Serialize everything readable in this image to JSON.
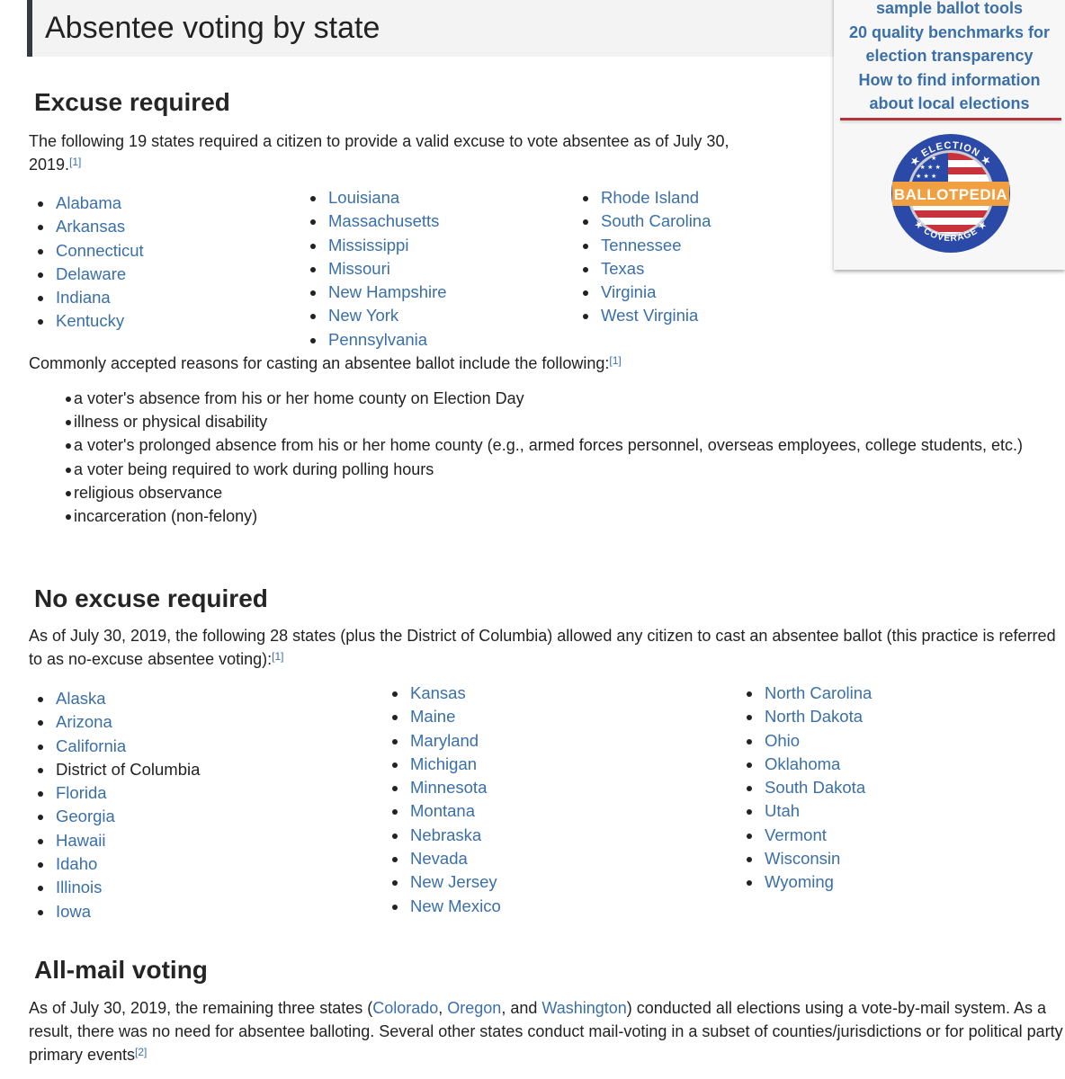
{
  "page_title": "Absentee voting by state",
  "sidebar": {
    "links": [
      "sample ballot tools",
      "20 quality benchmarks for",
      "election transparency",
      "How to find information",
      "about local elections"
    ],
    "logo": {
      "top_text": "ELECTION",
      "banner_text": "BALLOTPEDIA",
      "bottom_text": "COVERAGE",
      "colors": {
        "ring": "#2b4aa8",
        "banner": "#f0a040",
        "stripe": "#c8323a"
      }
    }
  },
  "sections": {
    "excuse_required": {
      "heading": "Excuse required",
      "intro_line1": "The following 19 states required a citizen to provide a valid excuse to vote absentee as of July 30,",
      "intro_line2": "2019.",
      "intro_ref": "[1]",
      "states_col1": [
        "Alabama",
        "Arkansas",
        "Connecticut",
        "Delaware",
        "Indiana",
        "Kentucky"
      ],
      "states_col2": [
        "Louisiana",
        "Massachusetts",
        "Mississippi",
        "Missouri",
        "New Hampshire",
        "New York",
        "Pennsylvania"
      ],
      "states_col3": [
        "Rhode Island",
        "South Carolina",
        "Tennessee",
        "Texas",
        "Virginia",
        "West Virginia"
      ],
      "reasons_intro": "Commonly accepted reasons for casting an absentee ballot include the following:",
      "reasons_ref": "[1]",
      "reasons": [
        "a voter's absence from his or her home county on Election Day",
        "illness or physical disability",
        "a voter's prolonged absence from his or her home county (e.g., armed forces personnel, overseas employees, college students, etc.)",
        "a voter being required to work during polling hours",
        "religious observance",
        "incarceration (non-felony)"
      ]
    },
    "no_excuse": {
      "heading": "No excuse required",
      "intro": "As of July 30, 2019, the following 28 states (plus the District of Columbia) allowed any citizen to cast an absentee ballot (this practice is referred to as no-excuse absentee voting):",
      "intro_ref": "[1]",
      "states_col1": [
        "Alaska",
        "Arizona",
        "California",
        "District of Columbia",
        "Florida",
        "Georgia",
        "Hawaii",
        "Idaho",
        "Illinois",
        "Iowa"
      ],
      "states_col2": [
        "Kansas",
        "Maine",
        "Maryland",
        "Michigan",
        "Minnesota",
        "Montana",
        "Nebraska",
        "Nevada",
        "New Jersey",
        "New Mexico"
      ],
      "states_col3": [
        "North Carolina",
        "North Dakota",
        "Ohio",
        "Oklahoma",
        "South Dakota",
        "Utah",
        "Vermont",
        "Wisconsin",
        "Wyoming"
      ],
      "unlinked": [
        "District of Columbia"
      ]
    },
    "all_mail": {
      "heading": "All-mail voting",
      "text_a": "As of July 30, 2019, the remaining three states (",
      "link1": "Colorado",
      "sep1": ", ",
      "link2": "Oregon",
      "sep2": ", and ",
      "link3": "Washington",
      "text_b": ") conducted all elections using a vote-by-mail system. As a result, there was no need for absentee balloting. Several other states conduct mail-voting in a subset of counties/jurisdictions or for political party primary events",
      "ref": "[2]"
    }
  }
}
